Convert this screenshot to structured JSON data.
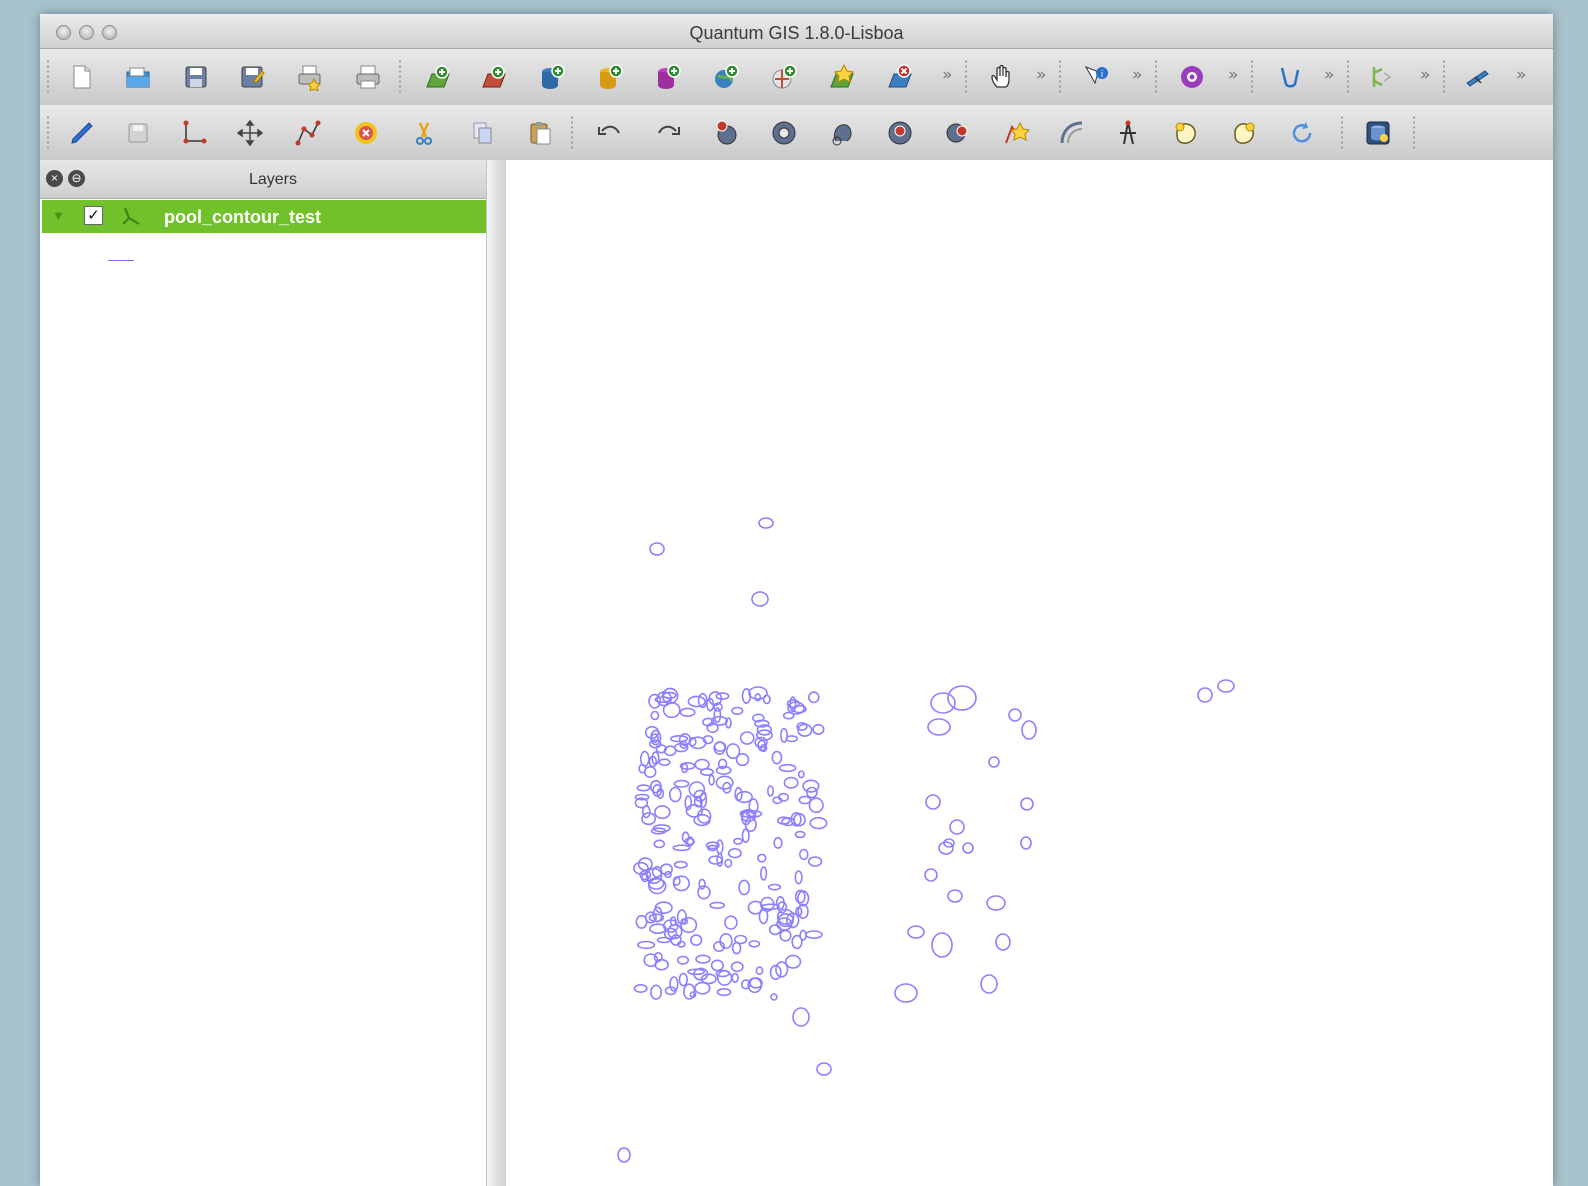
{
  "window": {
    "title": "Quantum GIS 1.8.0-Lisboa"
  },
  "toolbars": {
    "top_row": [
      {
        "name": "new-project-icon"
      },
      {
        "name": "open-project-icon"
      },
      {
        "name": "save-project-icon"
      },
      {
        "name": "save-as-icon"
      },
      {
        "name": "new-print-composer-icon"
      },
      {
        "name": "print-icon"
      },
      {
        "name": "add-vector-layer-icon"
      },
      {
        "name": "add-raster-layer-icon"
      },
      {
        "name": "add-postgis-layer-icon"
      },
      {
        "name": "add-spatialite-layer-icon"
      },
      {
        "name": "add-mssql-layer-icon"
      },
      {
        "name": "add-wms-layer-icon"
      },
      {
        "name": "add-wcs-layer-icon"
      },
      {
        "name": "new-shapefile-layer-icon"
      },
      {
        "name": "remove-layer-icon"
      },
      {
        "name": "pan-icon"
      },
      {
        "name": "identify-icon"
      },
      {
        "name": "gps-icon"
      },
      {
        "name": "plugin-icon"
      },
      {
        "name": "digitize-icon"
      },
      {
        "name": "label-icon"
      }
    ],
    "overflow_symbol": "»"
  },
  "layers_panel": {
    "title": "Layers",
    "layers": [
      {
        "name": "pool_contour_test",
        "visible": true
      }
    ]
  },
  "colors": {
    "layer_highlight": "#71c12a",
    "contour_stroke": "#8b80ff"
  }
}
